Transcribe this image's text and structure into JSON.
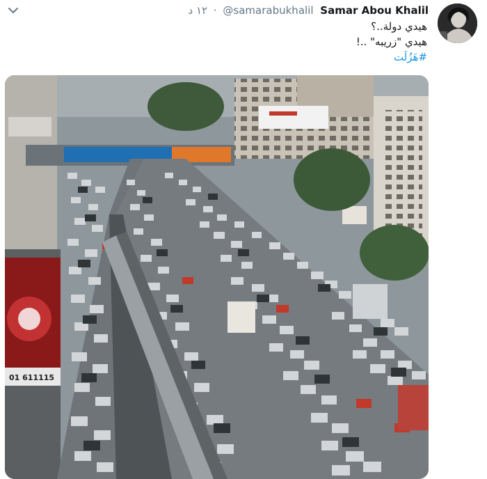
{
  "tweet": {
    "author_name": "Samar Abou Khalil",
    "author_handle": "@samarabukhalil",
    "separator": "·",
    "timestamp": "١٢ د",
    "text_lines": [
      "هيدي دولة..؟",
      "هيدي \"زريبه\" ..!"
    ],
    "hashtag": "#هَزُلَت",
    "menu_icon": "chevron-down-icon",
    "media": {
      "billboard_phone": "01 611115",
      "accent_colors": [
        "#1b95e0",
        "#14171a",
        "#657786"
      ]
    }
  }
}
